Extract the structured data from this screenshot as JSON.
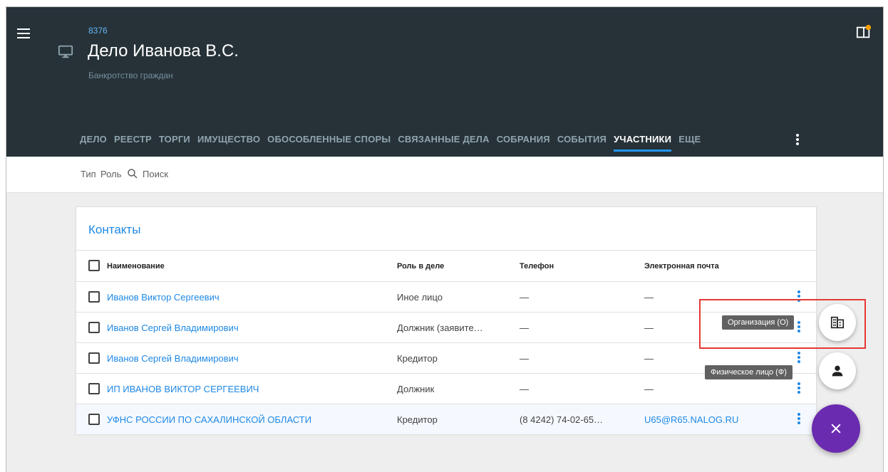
{
  "header": {
    "case_number": "8376",
    "case_title": "Дело Иванова В.С.",
    "case_subtitle": "Банкротство граждан"
  },
  "tabs": [
    {
      "label": "ДЕЛО"
    },
    {
      "label": "РЕЕСТР"
    },
    {
      "label": "ТОРГИ"
    },
    {
      "label": "ИМУЩЕСТВО"
    },
    {
      "label": "ОБОСОБЛЕННЫЕ СПОРЫ"
    },
    {
      "label": "СВЯЗАННЫЕ ДЕЛА"
    },
    {
      "label": "СОБРАНИЯ"
    },
    {
      "label": "СОБЫТИЯ"
    },
    {
      "label": "УЧАСТНИКИ",
      "active": true
    },
    {
      "label": "ЕЩЕ"
    }
  ],
  "filters": {
    "type_label": "Тип",
    "role_label": "Роль",
    "search_label": "Поиск"
  },
  "contacts": {
    "title": "Контакты",
    "columns": {
      "name": "Наименование",
      "role": "Роль в деле",
      "phone": "Телефон",
      "email": "Электронная почта"
    },
    "rows": [
      {
        "name": "Иванов Виктор Сергеевич",
        "role": "Иное лицо",
        "phone": "—",
        "email": "—"
      },
      {
        "name": "Иванов Сергей Владимирович",
        "role": "Должник (заявите…",
        "phone": "—",
        "email": "—"
      },
      {
        "name": "Иванов Сергей Владимирович",
        "role": "Кредитор",
        "phone": "—",
        "email": "—"
      },
      {
        "name": "ИП ИВАНОВ ВИКТОР СЕРГЕЕВИЧ",
        "role": "Должник",
        "phone": "—",
        "email": "—"
      },
      {
        "name": "УФНС РОССИИ ПО САХАЛИНСКОЙ ОБЛАСТИ",
        "role": "Кредитор",
        "phone": "(8 4242) 74-02-65…",
        "email": "U65@R65.NALOG.RU"
      }
    ]
  },
  "fab": {
    "organization_tooltip": "Организация (О)",
    "person_tooltip": "Физическое лицо (Ф)"
  },
  "colors": {
    "header_bg": "#263238",
    "accent": "#1e88e5",
    "fab": "#6a2bb0",
    "highlight": "#e53935"
  }
}
